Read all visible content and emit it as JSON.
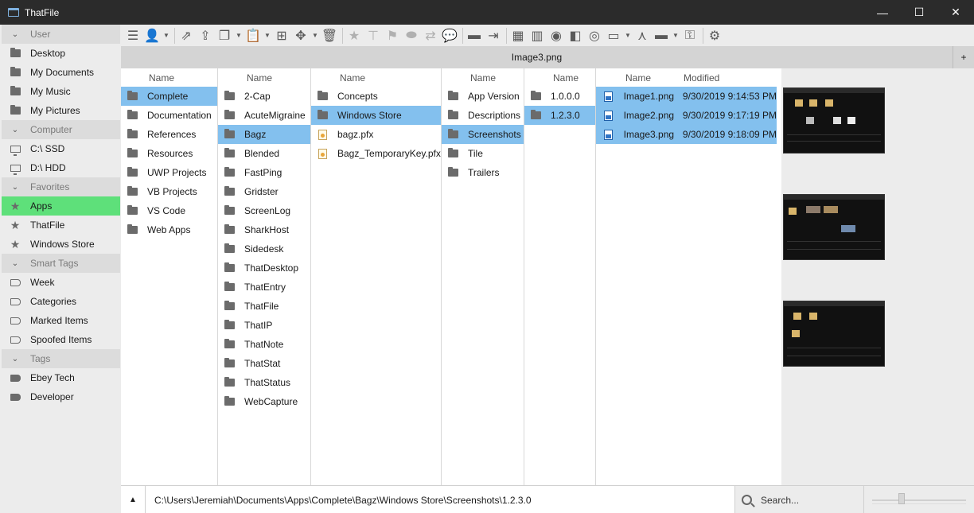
{
  "window": {
    "title": "ThatFile",
    "controls": [
      "—",
      "☐",
      "✕"
    ]
  },
  "sidebar": {
    "sections": [
      {
        "header": "User",
        "items": [
          {
            "label": "Desktop",
            "icon": "folder-icon"
          },
          {
            "label": "My Documents",
            "icon": "folder-icon"
          },
          {
            "label": "My Music",
            "icon": "folder-icon"
          },
          {
            "label": "My Pictures",
            "icon": "folder-icon"
          }
        ]
      },
      {
        "header": "Computer",
        "items": [
          {
            "label": "C:\\ SSD",
            "icon": "monitor-icon"
          },
          {
            "label": "D:\\ HDD",
            "icon": "monitor-icon"
          }
        ]
      },
      {
        "header": "Favorites",
        "items": [
          {
            "label": "Apps",
            "icon": "star-icon",
            "active": true
          },
          {
            "label": "ThatFile",
            "icon": "star-icon"
          },
          {
            "label": "Windows Store",
            "icon": "star-icon"
          }
        ]
      },
      {
        "header": "Smart Tags",
        "items": [
          {
            "label": "Week",
            "icon": "tag-outline-icon"
          },
          {
            "label": "Categories",
            "icon": "tag-outline-icon"
          },
          {
            "label": "Marked Items",
            "icon": "tag-outline-icon"
          },
          {
            "label": "Spoofed Items",
            "icon": "tag-outline-icon"
          }
        ]
      },
      {
        "header": "Tags",
        "items": [
          {
            "label": "Ebey Tech",
            "icon": "tag-filled-icon"
          },
          {
            "label": "Developer",
            "icon": "tag-filled-icon"
          }
        ]
      }
    ]
  },
  "toolbar": {
    "buttons": [
      {
        "name": "menu-icon",
        "glyph": "☰"
      },
      {
        "name": "user-icon",
        "glyph": "👤",
        "caret": true
      },
      {
        "sep": true
      },
      {
        "name": "open-external-icon",
        "glyph": "⇗"
      },
      {
        "name": "open-up-icon",
        "glyph": "⇪"
      },
      {
        "name": "copy-icon",
        "glyph": "❐",
        "caret": true
      },
      {
        "name": "paste-icon",
        "glyph": "📋",
        "caret": true
      },
      {
        "name": "new-item-icon",
        "glyph": "⊞"
      },
      {
        "name": "move-icon",
        "glyph": "✥",
        "caret": true
      },
      {
        "name": "delete-icon",
        "glyph": "🗑"
      },
      {
        "sep": true
      },
      {
        "name": "favorite-star-icon",
        "glyph": "★",
        "dim": true
      },
      {
        "name": "pin-top-icon",
        "glyph": "⊤",
        "dim": true
      },
      {
        "name": "flag-icon",
        "glyph": "⚑",
        "dim": true
      },
      {
        "name": "tag-icon",
        "glyph": "⬬",
        "dim": true
      },
      {
        "name": "swap-icon",
        "glyph": "⇄",
        "dim": true
      },
      {
        "name": "comment-icon",
        "glyph": "💬"
      },
      {
        "sep": true
      },
      {
        "name": "folder-icon",
        "glyph": "▬"
      },
      {
        "name": "rename-icon",
        "glyph": "⇥"
      },
      {
        "sep": true
      },
      {
        "name": "tiles-view-icon",
        "glyph": "▦"
      },
      {
        "name": "columns-view-icon",
        "glyph": "▥"
      },
      {
        "name": "preview-eye-icon",
        "glyph": "◉"
      },
      {
        "name": "compare-icon",
        "glyph": "◧"
      },
      {
        "name": "compass-icon",
        "glyph": "◎"
      },
      {
        "name": "window-icon",
        "glyph": "▭",
        "caret": true
      },
      {
        "name": "merge-icon",
        "glyph": "⋏"
      },
      {
        "name": "layout-bar-icon",
        "glyph": "▬",
        "caret": true
      },
      {
        "name": "key-icon",
        "glyph": "⚿"
      },
      {
        "sep": true
      },
      {
        "name": "settings-gear-icon",
        "glyph": "⚙"
      }
    ]
  },
  "preview_header": {
    "title": "Image3.png",
    "add_label": "+"
  },
  "columns": [
    {
      "header": "Name",
      "rows": [
        {
          "label": "Complete",
          "icon": "folder",
          "selected": true
        },
        {
          "label": "Documentation",
          "icon": "folder"
        },
        {
          "label": "References",
          "icon": "folder"
        },
        {
          "label": "Resources",
          "icon": "folder"
        },
        {
          "label": "UWP Projects",
          "icon": "folder"
        },
        {
          "label": "VB Projects",
          "icon": "folder"
        },
        {
          "label": "VS Code",
          "icon": "folder"
        },
        {
          "label": "Web Apps",
          "icon": "folder"
        }
      ]
    },
    {
      "header": "Name",
      "rows": [
        {
          "label": "2-Cap",
          "icon": "folder"
        },
        {
          "label": "AcuteMigraine",
          "icon": "folder"
        },
        {
          "label": "Bagz",
          "icon": "folder",
          "selected": true
        },
        {
          "label": "Blended",
          "icon": "folder"
        },
        {
          "label": "FastPing",
          "icon": "folder"
        },
        {
          "label": "Gridster",
          "icon": "folder"
        },
        {
          "label": "ScreenLog",
          "icon": "folder"
        },
        {
          "label": "SharkHost",
          "icon": "folder"
        },
        {
          "label": "Sidedesk",
          "icon": "folder"
        },
        {
          "label": "ThatDesktop",
          "icon": "folder"
        },
        {
          "label": "ThatEntry",
          "icon": "folder"
        },
        {
          "label": "ThatFile",
          "icon": "folder"
        },
        {
          "label": "ThatIP",
          "icon": "folder"
        },
        {
          "label": "ThatNote",
          "icon": "folder"
        },
        {
          "label": "ThatStat",
          "icon": "folder"
        },
        {
          "label": "ThatStatus",
          "icon": "folder"
        },
        {
          "label": "WebCapture",
          "icon": "folder"
        }
      ]
    },
    {
      "header": "Name",
      "rows": [
        {
          "label": "Concepts",
          "icon": "folder"
        },
        {
          "label": "Windows Store",
          "icon": "folder",
          "selected": true
        },
        {
          "label": "bagz.pfx",
          "icon": "file"
        },
        {
          "label": "Bagz_TemporaryKey.pfx",
          "icon": "file"
        }
      ]
    },
    {
      "header": "Name",
      "rows": [
        {
          "label": "App Version",
          "icon": "folder"
        },
        {
          "label": "Descriptions",
          "icon": "folder"
        },
        {
          "label": "Screenshots",
          "icon": "folder",
          "selected": true
        },
        {
          "label": "Tile",
          "icon": "folder"
        },
        {
          "label": "Trailers",
          "icon": "folder"
        }
      ]
    },
    {
      "header": "Name",
      "rows": [
        {
          "label": "1.0.0.0",
          "icon": "folder"
        },
        {
          "label": "1.2.3.0",
          "icon": "folder",
          "selected": true
        }
      ]
    }
  ],
  "files_column": {
    "headers": {
      "name": "Name",
      "modified": "Modified"
    },
    "rows": [
      {
        "name": "Image1.png",
        "modified": "9/30/2019 9:14:53 PM"
      },
      {
        "name": "Image2.png",
        "modified": "9/30/2019 9:17:19 PM"
      },
      {
        "name": "Image3.png",
        "modified": "9/30/2019 9:18:09 PM"
      }
    ]
  },
  "statusbar": {
    "up_glyph": "▲",
    "path": "C:\\Users\\Jeremiah\\Documents\\Apps\\Complete\\Bagz\\Windows Store\\Screenshots\\1.2.3.0",
    "search_placeholder": "Search...",
    "zoom_level": 0.3
  },
  "colors": {
    "selection": "#83c0ee",
    "active_favorite": "#5ee07a",
    "titlebar": "#2b2b2b"
  }
}
